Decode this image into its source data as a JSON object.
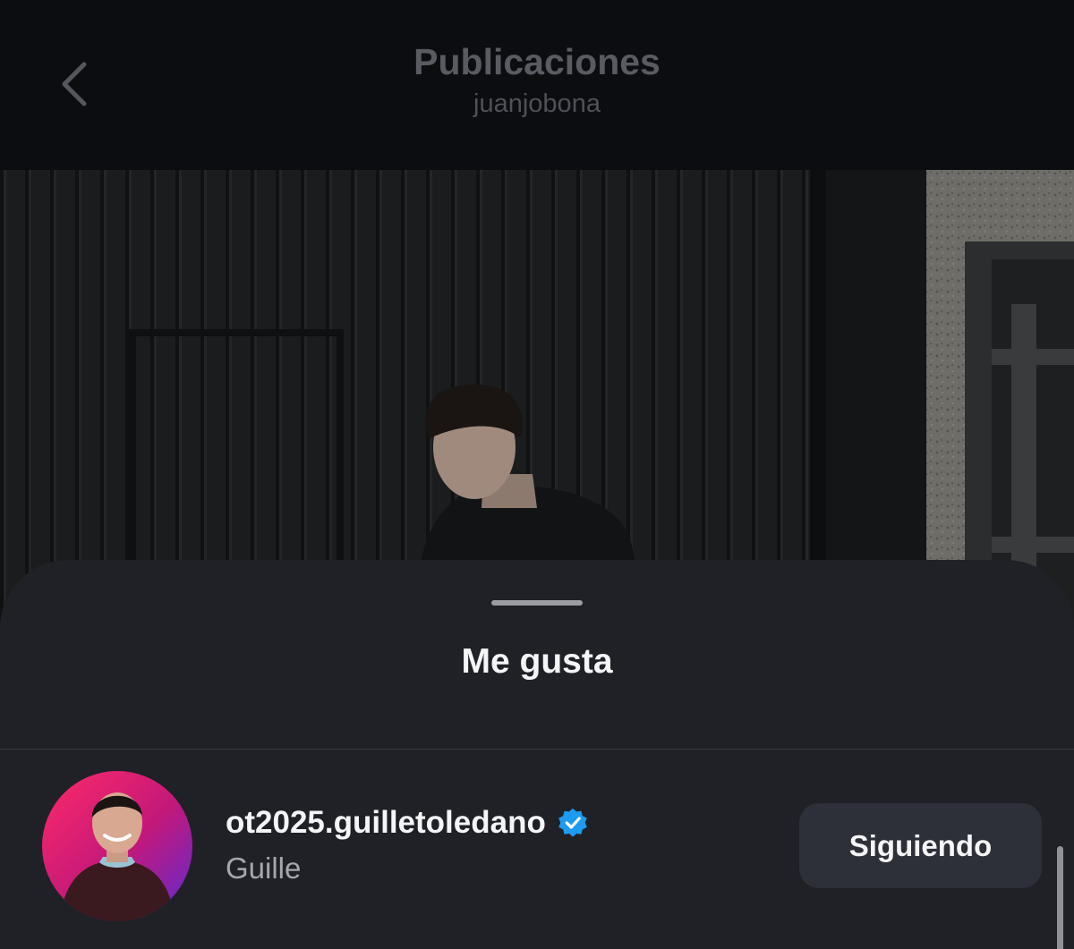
{
  "header": {
    "title": "Publicaciones",
    "subtitle": "juanjobona",
    "back_icon": "chevron-left-icon"
  },
  "post": {
    "description_hidden": true
  },
  "likes_sheet": {
    "title": "Me gusta",
    "items": [
      {
        "username": "ot2025.guilletoledano",
        "verified": true,
        "verified_color": "#1d9bf0",
        "full_name": "Guille",
        "follow_label": "Siguiendo"
      }
    ]
  },
  "colors": {
    "background": "#0b0d10",
    "sheet": "#1f2126",
    "button": "#2d3038",
    "text_primary": "#f4f5f7",
    "text_secondary": "#a4a7ad"
  }
}
